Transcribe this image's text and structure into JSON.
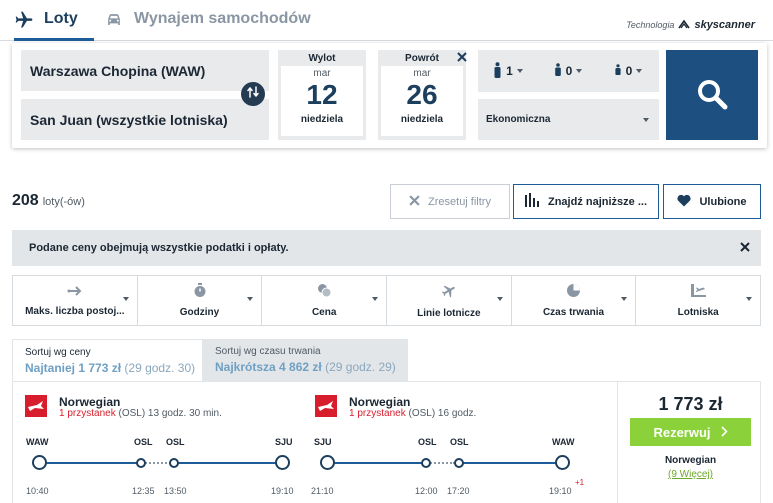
{
  "tabs": {
    "flights_label": "Loty",
    "cars_label": "Wynajem samochodów"
  },
  "brand": {
    "prefix": "Technologia",
    "logo": "skyscanner"
  },
  "search": {
    "origin": "Warszawa Chopina (WAW)",
    "destination": "San Juan (wszystkie lotniska)",
    "depart": {
      "label": "Wylot",
      "month": "mar",
      "day": "12",
      "weekday": "niedziela"
    },
    "return": {
      "label": "Powrót",
      "month": "mar",
      "day": "26",
      "weekday": "niedziela"
    },
    "passengers": {
      "adults": "1",
      "children": "0",
      "infants": "0"
    },
    "cabin_class": "Ekonomiczna"
  },
  "results": {
    "count": "208",
    "count_unit": "loty(-ów)",
    "reset_label": "Zresetuj filtry",
    "lowest_label": "Znajdź najniższe ...",
    "favorites_label": "Ulubione",
    "notice": "Podane ceny obejmują wszystkie podatki i opłaty."
  },
  "filters": [
    {
      "label": "Maks. liczba postoj...",
      "icon": "arrow-right-icon"
    },
    {
      "label": "Godziny",
      "icon": "stopwatch-icon"
    },
    {
      "label": "Cena",
      "icon": "coins-icon"
    },
    {
      "label": "Linie lotnicze",
      "icon": "plane-icon"
    },
    {
      "label": "Czas trwania",
      "icon": "clock-icon"
    },
    {
      "label": "Lotniska",
      "icon": "airport-icon"
    }
  ],
  "sort": {
    "price_title": "Sortuj wg ceny",
    "price_prefix": "Najtaniej",
    "price_value": "1 773 zł",
    "price_duration": "(29 godz. 30)",
    "duration_title": "Sortuj wg czasu trwania",
    "duration_prefix": "Najkrótsza",
    "duration_value": "4 862 zł",
    "duration_duration": "(29 godz. 29)"
  },
  "result": {
    "outbound": {
      "airline": "Norwegian",
      "stops": "1 przystanek",
      "stop_detail": "(OSL) 13 godz. 30 min.",
      "codes": [
        "WAW",
        "OSL",
        "OSL",
        "SJU"
      ],
      "times": [
        "10:40",
        "12:35",
        "13:50",
        "19:10"
      ]
    },
    "inbound": {
      "airline": "Norwegian",
      "stops": "1 przystanek",
      "stop_detail": "(OSL) 16 godz.",
      "codes": [
        "SJU",
        "OSL",
        "OSL",
        "WAW"
      ],
      "times": [
        "21:10",
        "12:00",
        "17:20",
        "19:10"
      ],
      "day_offset": "+1"
    },
    "price": "1 773 zł",
    "book_label": "Rezerwuj",
    "book_airline": "Norwegian",
    "more_link": "(9 Więcej)"
  },
  "colors": {
    "primary_blue": "#1d4f80",
    "book_green": "#8ad13a",
    "norwegian_red": "#d81e2c"
  }
}
